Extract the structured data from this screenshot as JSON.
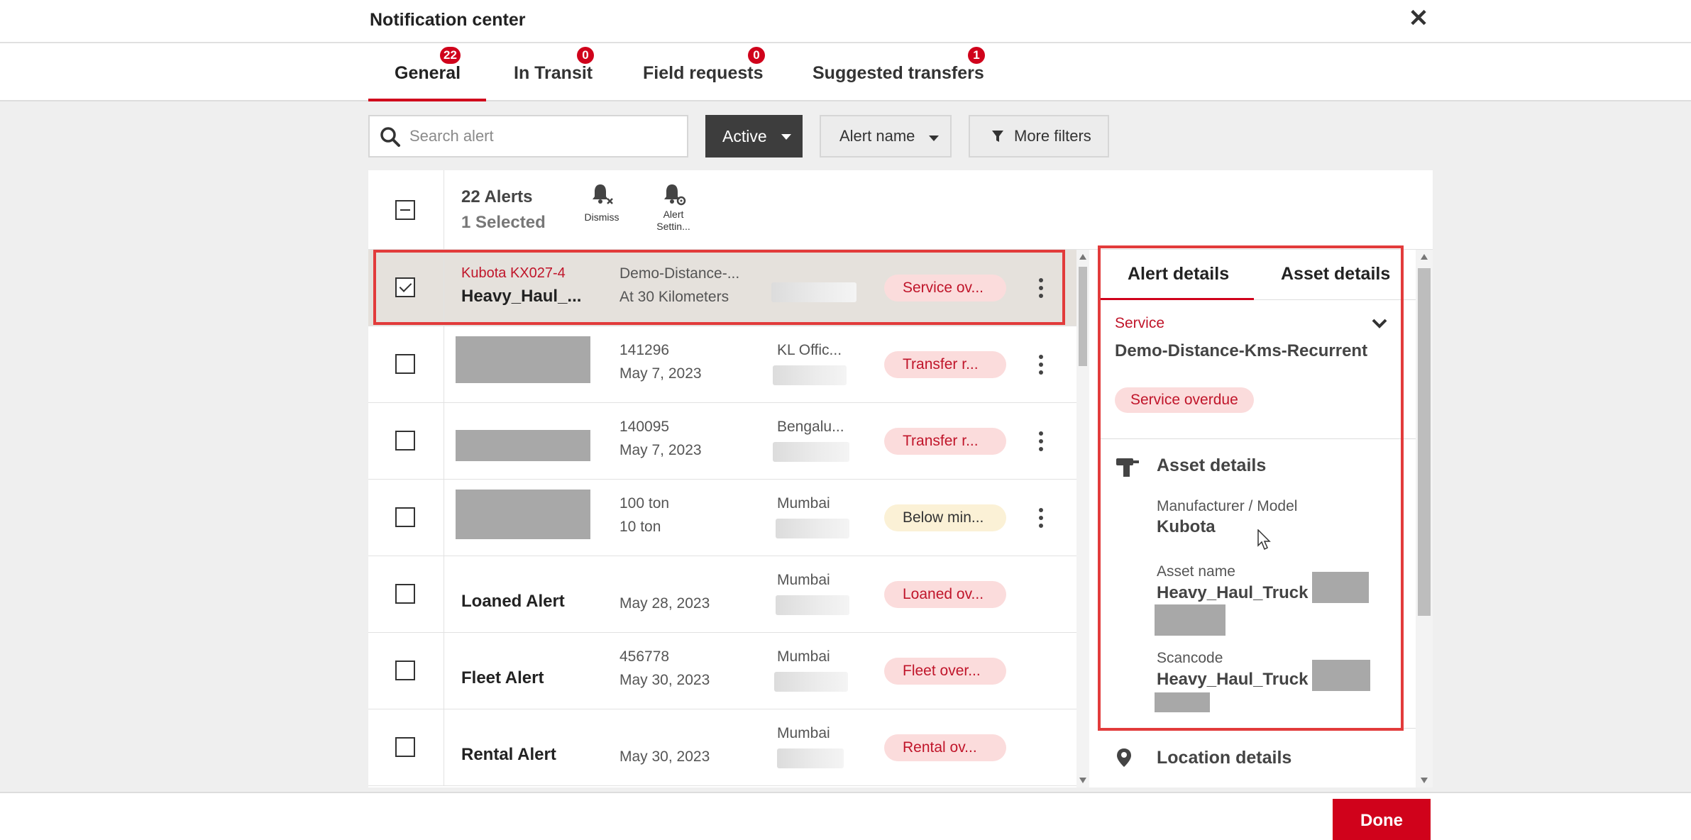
{
  "header": {
    "title": "Notification center"
  },
  "tabs": [
    {
      "label": "General",
      "badge": "22"
    },
    {
      "label": "In Transit",
      "badge": "0"
    },
    {
      "label": "Field requests",
      "badge": "0"
    },
    {
      "label": "Suggested transfers",
      "badge": "1"
    }
  ],
  "filters": {
    "search_placeholder": "Search alert",
    "status": "Active",
    "alert_name": "Alert name",
    "more_filters": "More filters"
  },
  "list": {
    "count_label": "22 Alerts",
    "selected_label": "1 Selected",
    "dismiss_label": "Dismiss",
    "settings_label": "Alert Settin...",
    "rows": [
      {
        "asset": "Kubota KX027-4",
        "name": "Heavy_Haul_...",
        "detail1": "Demo-Distance-...",
        "detail2": "At 30 Kilometers",
        "location": "",
        "status": "Service ov..."
      },
      {
        "detail1": "141296",
        "detail2": "May 7, 2023",
        "location": "KL Offic...",
        "status": "Transfer r..."
      },
      {
        "detail1": "140095",
        "detail2": "May 7, 2023",
        "location": "Bengalu...",
        "status": "Transfer r..."
      },
      {
        "detail1": "100 ton",
        "detail2": "10 ton",
        "location": "Mumbai",
        "status": "Below min..."
      },
      {
        "name": "Loaned Alert",
        "detail2": "May 28, 2023",
        "location": "Mumbai",
        "status": "Loaned ov..."
      },
      {
        "name": "Fleet Alert",
        "detail1": "456778",
        "detail2": "May 30, 2023",
        "location": "Mumbai",
        "status": "Fleet over..."
      },
      {
        "name": "Rental Alert",
        "detail2": "May 30, 2023",
        "location": "Mumbai",
        "status": "Rental ov..."
      }
    ]
  },
  "details": {
    "tabs": [
      "Alert details",
      "Asset details"
    ],
    "category": "Service",
    "alert_name": "Demo-Distance-Kms-Recurrent",
    "status": "Service overdue",
    "asset_section": "Asset details",
    "manufacturer_label": "Manufacturer / Model",
    "manufacturer_value": "Kubota",
    "asset_name_label": "Asset name",
    "asset_name_value": "Heavy_Haul_Truck",
    "scancode_label": "Scancode",
    "scancode_value": "Heavy_Haul_Truck",
    "location_section": "Location details"
  },
  "footer": {
    "done_label": "Done"
  },
  "colors": {
    "accent": "#d0021b",
    "pill_red_bg": "#fbdcdc",
    "pill_yellow_bg": "#fbf1d6",
    "selected_row": "#e5e1dc",
    "highlight_box": "#e23b3b"
  }
}
